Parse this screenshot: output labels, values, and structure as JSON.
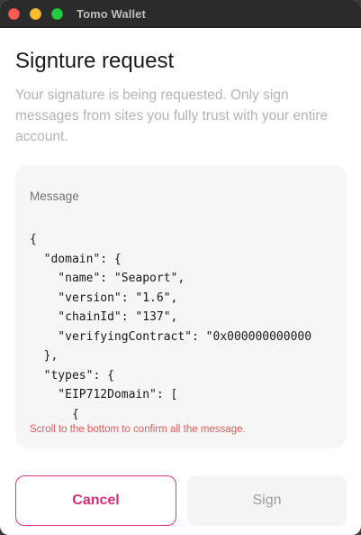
{
  "window": {
    "title": "Tomo Wallet"
  },
  "header": {
    "title": "Signture request",
    "subtitle": "Your signature is being requested. Only sign messages from sites you fully trust with your entire account."
  },
  "message": {
    "label": "Message",
    "content": "{\n  \"domain\": {\n    \"name\": \"Seaport\",\n    \"version\": \"1.6\",\n    \"chainId\": \"137\",\n    \"verifyingContract\": \"0x000000000000\n  },\n  \"types\": {\n    \"EIP712Domain\": [\n      {",
    "scroll_hint": "Scroll to the bottom to confirm all the message."
  },
  "actions": {
    "cancel_label": "Cancel",
    "sign_label": "Sign"
  },
  "colors": {
    "accent": "#d42e77",
    "warning_text": "#e05a5a",
    "titlebar": "#2b2b2b"
  }
}
